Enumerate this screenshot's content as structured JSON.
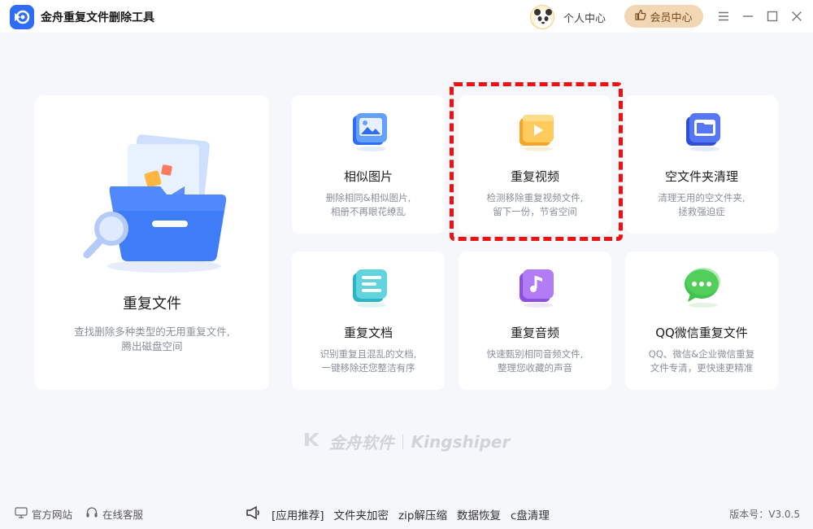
{
  "titlebar": {
    "app_title": "金舟重复文件删除工具",
    "user_center": "个人中心",
    "vip_center": "会员中心",
    "icons": [
      "menu-icon",
      "minimize-icon",
      "maximize-icon",
      "close-icon"
    ]
  },
  "cards": {
    "duplicate_files": {
      "title": "重复文件",
      "desc_line1": "查找删除多种类型的无用重复文件,",
      "desc_line2": "腾出磁盘空间",
      "icon": "folder-icon"
    },
    "similar_images": {
      "title": "相似图片",
      "desc_line1": "删除相同&相似图片,",
      "desc_line2": "相册不再眼花缭乱",
      "icon": "image-icon"
    },
    "duplicate_videos": {
      "title": "重复视频",
      "desc_line1": "检测移除重复视频文件,",
      "desc_line2": "留下一份，节省空间",
      "icon": "video-icon"
    },
    "empty_folders": {
      "title": "空文件夹清理",
      "desc_line1": "清理无用的空文件夹,",
      "desc_line2": "拯救强迫症",
      "icon": "empty-folder-icon"
    },
    "duplicate_docs": {
      "title": "重复文档",
      "desc_line1": "识别重复且混乱的文档,",
      "desc_line2": "一键移除还您整洁有序",
      "icon": "document-icon"
    },
    "duplicate_audio": {
      "title": "重复音频",
      "desc_line1": "快速甄别相同音频文件,",
      "desc_line2": "整理您收藏的声音",
      "icon": "music-icon"
    },
    "qq_wechat": {
      "title": "QQ微信重复文件",
      "desc_line1": "QQ、微信&企业微信重复",
      "desc_line2": "文件专清，更快速更精准",
      "icon": "chat-icon"
    }
  },
  "watermark": {
    "cn": "金舟软件",
    "en": "Kingshiper"
  },
  "footer": {
    "official_site": "官方网站",
    "online_service": "在线客服",
    "recommend_label": "[应用推荐]",
    "recommend_items": [
      "文件夹加密",
      "zip解压缩",
      "数据恢复",
      "c盘清理"
    ],
    "version": "版本号：V3.0.5"
  },
  "colors": {
    "accent_blue": "#2f6cf6",
    "vip_bg": "#f1d7b3",
    "highlight_red": "#ee1111",
    "background": "#f6f7fb"
  }
}
